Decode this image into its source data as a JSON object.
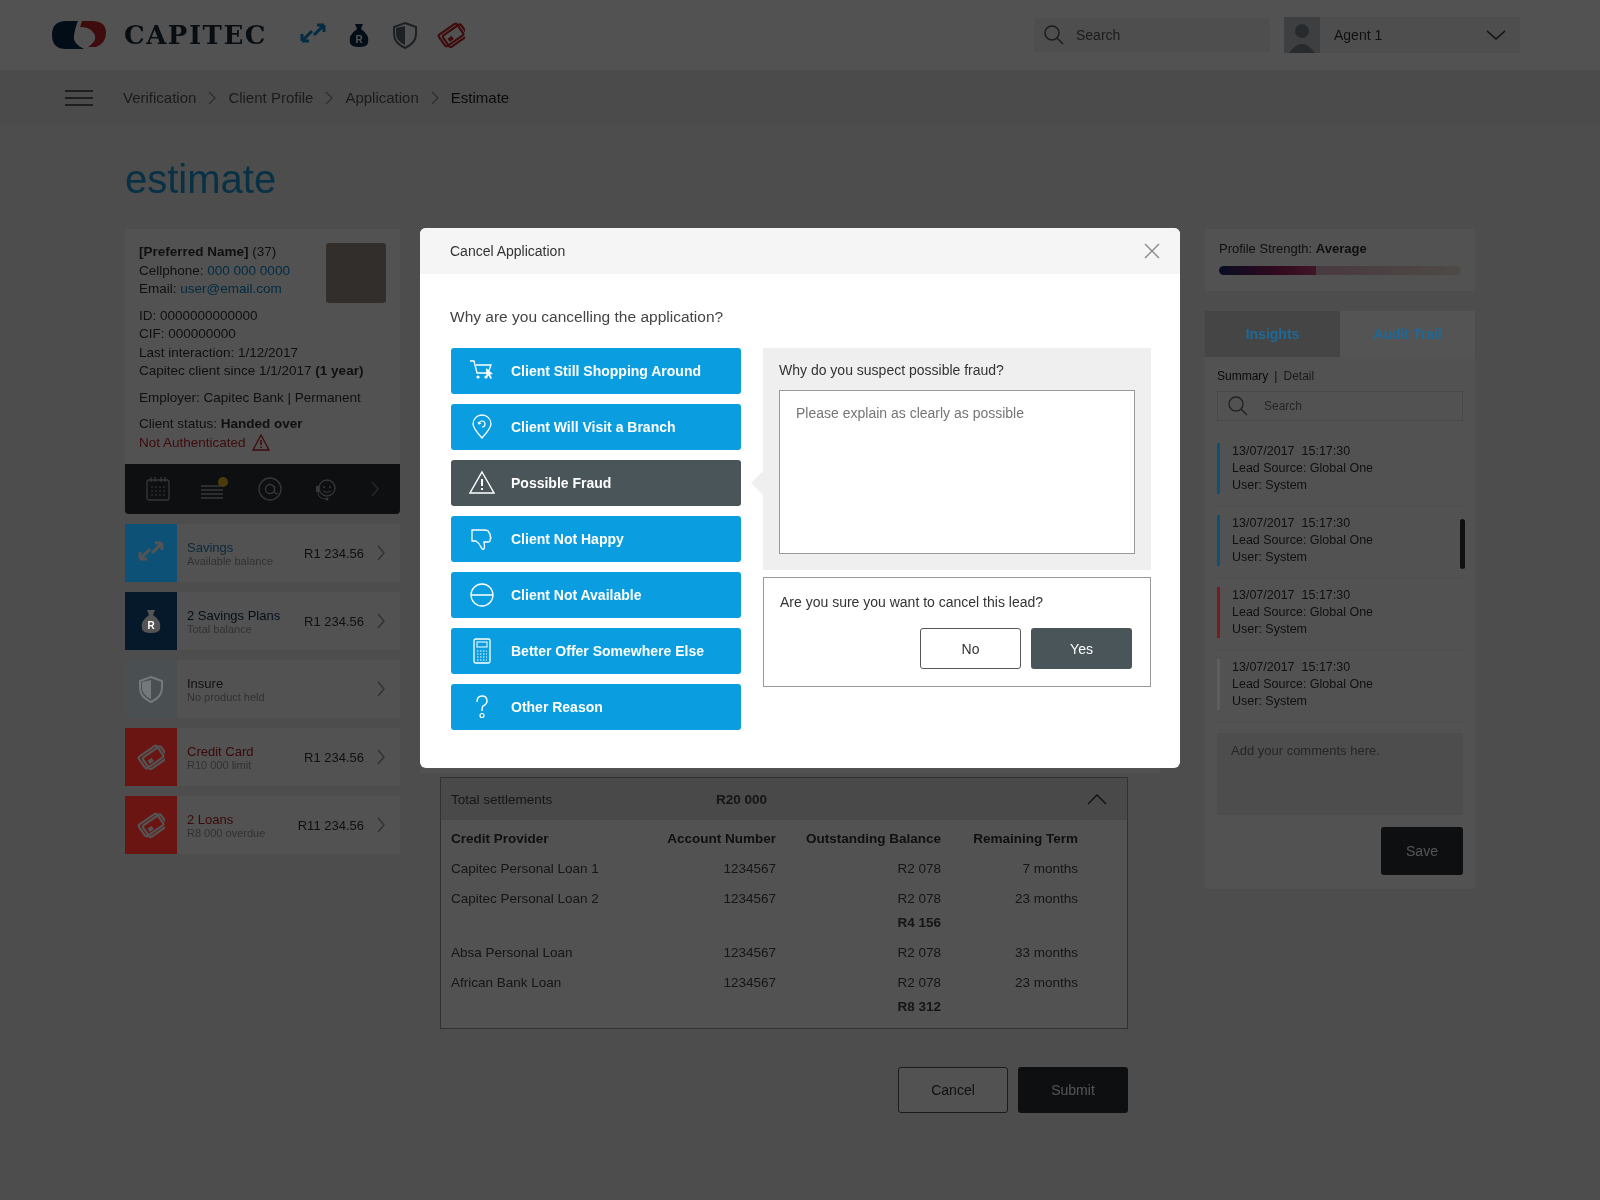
{
  "header": {
    "logo_text": "CAPITEC",
    "nav_icons": [
      {
        "kind": "savings"
      },
      {
        "kind": "plans",
        "mark": "R"
      },
      {
        "kind": "insure"
      },
      {
        "kind": "card"
      }
    ],
    "search": {
      "placeholder": "Search"
    },
    "user": {
      "name": "Agent 1"
    }
  },
  "breadcrumb": [
    {
      "label": "Verification",
      "current": false
    },
    {
      "label": "Client Profile",
      "current": false
    },
    {
      "label": "Application",
      "current": false
    },
    {
      "label": "Estimate",
      "current": true
    }
  ],
  "page_title": "estimate",
  "client": {
    "name_line": "**[Preferred Name]** (37)",
    "cellphone": {
      "label": "Cellphone:",
      "value": "000 000 0000"
    },
    "email": {
      "label": "Email:",
      "value": "user@email.com"
    },
    "details": [
      "ID: 0000000000000",
      "CIF: 000000000",
      "Last interaction: 1/12/2017",
      "Capitec client since 1/1/2017 **(1 year)**"
    ],
    "employer": "Employer: Capitec Bank | Permanent",
    "status": "Client status: **Handed over**",
    "authentication": "Not Authenticated",
    "authenticated": false
  },
  "actions": [
    {
      "kind": "calendar",
      "notification": false
    },
    {
      "kind": "notes",
      "notification": true
    },
    {
      "kind": "email",
      "notification": false
    },
    {
      "kind": "support",
      "notification": false
    }
  ],
  "products": [
    {
      "kind": "savings",
      "name": "Savings",
      "sub": "Available balance",
      "amount": "R1 234.56",
      "color": "#0d5177",
      "held": true
    },
    {
      "kind": "plans",
      "name": "2 Savings Plans",
      "sub": "Total balance",
      "amount": "R1 234.56",
      "color": "#05192a",
      "held": true,
      "mark": "R"
    },
    {
      "kind": "insure",
      "name": "Insure",
      "sub": "No product held",
      "color": "#4a4f52",
      "held": false
    },
    {
      "kind": "card",
      "name": "Credit Card",
      "sub": "R10 000 limit",
      "amount": "R1 234.56",
      "color": "#6b1512",
      "held": true
    },
    {
      "kind": "card",
      "name": "2 Loans",
      "sub": "R8 000 overdue",
      "amount": "R11 234.56",
      "color": "#6b1512",
      "held": true
    }
  ],
  "profile_strength": {
    "label": "Profile Strength:",
    "value": "Average",
    "level": 0.4
  },
  "tabs": [
    {
      "label": "Insights",
      "selected": false
    },
    {
      "label": "Audit Trail",
      "selected": true
    }
  ],
  "views": [
    {
      "label": "Summary",
      "selected": true
    },
    {
      "label": "Detail",
      "selected": false
    }
  ],
  "views_separator": "|",
  "audit_search": {
    "placeholder": "Search"
  },
  "audit": [
    {
      "datetime": "13/07/2017  15:17:30",
      "source": "Lead Source: Global One",
      "user": "User: System",
      "color": "#0d5177"
    },
    {
      "datetime": "13/07/2017  15:17:30",
      "source": "Lead Source: Global One",
      "user": "User: System",
      "color": "#0d5177"
    },
    {
      "datetime": "13/07/2017  15:17:30",
      "source": "Lead Source: Global One",
      "user": "User: System",
      "color": "#7a1a1a"
    },
    {
      "datetime": "13/07/2017  15:17:30",
      "source": "Lead Source: Global One",
      "user": "User: System",
      "color": "#5e5e5e"
    }
  ],
  "comments": {
    "placeholder": "Add your comments here."
  },
  "save_button": "Save",
  "settlements": {
    "label": "Total settlements",
    "total": "R20 000",
    "expanded": true,
    "columns": [
      "Credit Provider",
      "Account Number",
      "Outstanding Balance",
      "Remaining Term"
    ],
    "rows": [
      {
        "kind": "row",
        "cells": [
          "Capitec Personal Loan 1",
          "1234567",
          "R2 078",
          "7 months"
        ]
      },
      {
        "kind": "row",
        "cells": [
          "Capitec Personal Loan 2",
          "1234567",
          "R2 078",
          "23 months"
        ]
      },
      {
        "kind": "subtotal",
        "value": "R4 156"
      },
      {
        "kind": "row",
        "cells": [
          "Absa Personal Loan",
          "1234567",
          "R2 078",
          "33 months"
        ]
      },
      {
        "kind": "row",
        "cells": [
          "African Bank Loan",
          "1234567",
          "R2 078",
          "23 months"
        ]
      },
      {
        "kind": "subtotal",
        "value": "R8 312"
      }
    ]
  },
  "footer_buttons": [
    {
      "kind": "secondary",
      "label": "Cancel"
    },
    {
      "kind": "primary",
      "label": "Submit"
    }
  ],
  "modal": {
    "title": "Cancel Application",
    "question": "Why are you cancelling the application?",
    "reasons": [
      {
        "kind": "cart",
        "label": "Client Still Shopping Around",
        "selected": false
      },
      {
        "kind": "pin",
        "label": "Client Will Visit a Branch",
        "selected": false
      },
      {
        "kind": "warning",
        "label": "Possible Fraud",
        "selected": true
      },
      {
        "kind": "thumbs-down",
        "label": "Client Not Happy",
        "selected": false
      },
      {
        "kind": "no-entry",
        "label": "Client Not Available",
        "selected": false
      },
      {
        "kind": "calculator",
        "label": "Better Offer Somewhere Else",
        "selected": false
      },
      {
        "kind": "question",
        "label": "Other Reason",
        "selected": false
      }
    ],
    "detail": {
      "question": "Why do you suspect possible fraud?",
      "placeholder": "Please explain as clearly as possible"
    },
    "confirm": {
      "question": "Are you sure you want to cancel this lead?",
      "buttons": [
        {
          "kind": "secondary",
          "label": "No"
        },
        {
          "kind": "primary",
          "label": "Yes"
        }
      ]
    }
  }
}
